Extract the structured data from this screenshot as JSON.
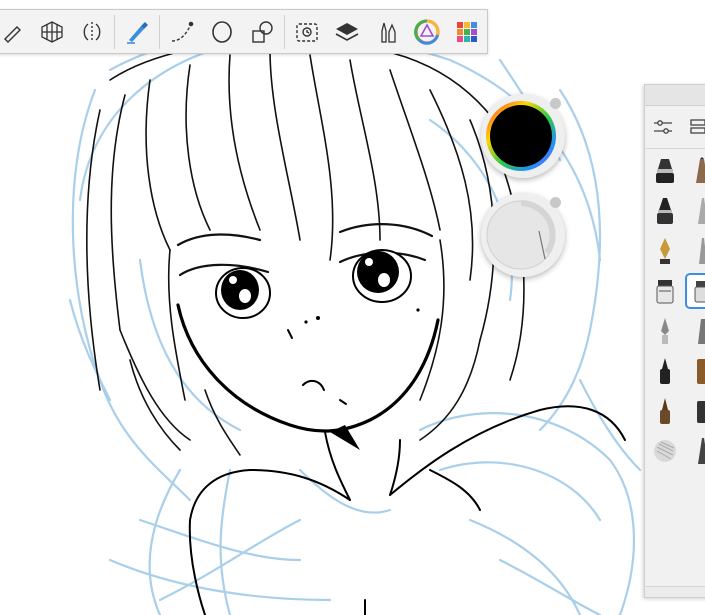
{
  "app": {
    "canvas": {
      "subject": ""
    },
    "toolbar": {
      "tools": [
        {
          "name": "edit-icon"
        },
        {
          "name": "perspective-guide-icon"
        },
        {
          "name": "symmetry-icon"
        },
        {
          "name": "brush-icon",
          "active": true
        },
        {
          "name": "curve-ruler-icon"
        },
        {
          "name": "ellipse-icon"
        },
        {
          "name": "shapes-icon"
        },
        {
          "name": "timelapse-icon"
        },
        {
          "name": "layers-icon"
        },
        {
          "name": "brush-library-icon"
        },
        {
          "name": "color-wheel-icon"
        },
        {
          "name": "copic-palette-icon"
        }
      ]
    },
    "color_puck": {
      "current_color": "#000000"
    },
    "brush_panel": {
      "selected_brush_index": 6
    },
    "colors": {
      "accent": "#3a8fe0",
      "sketch_blue": "#a9cfea",
      "ink": "#111111",
      "toolbar_bg": "#f3f3f3"
    }
  }
}
